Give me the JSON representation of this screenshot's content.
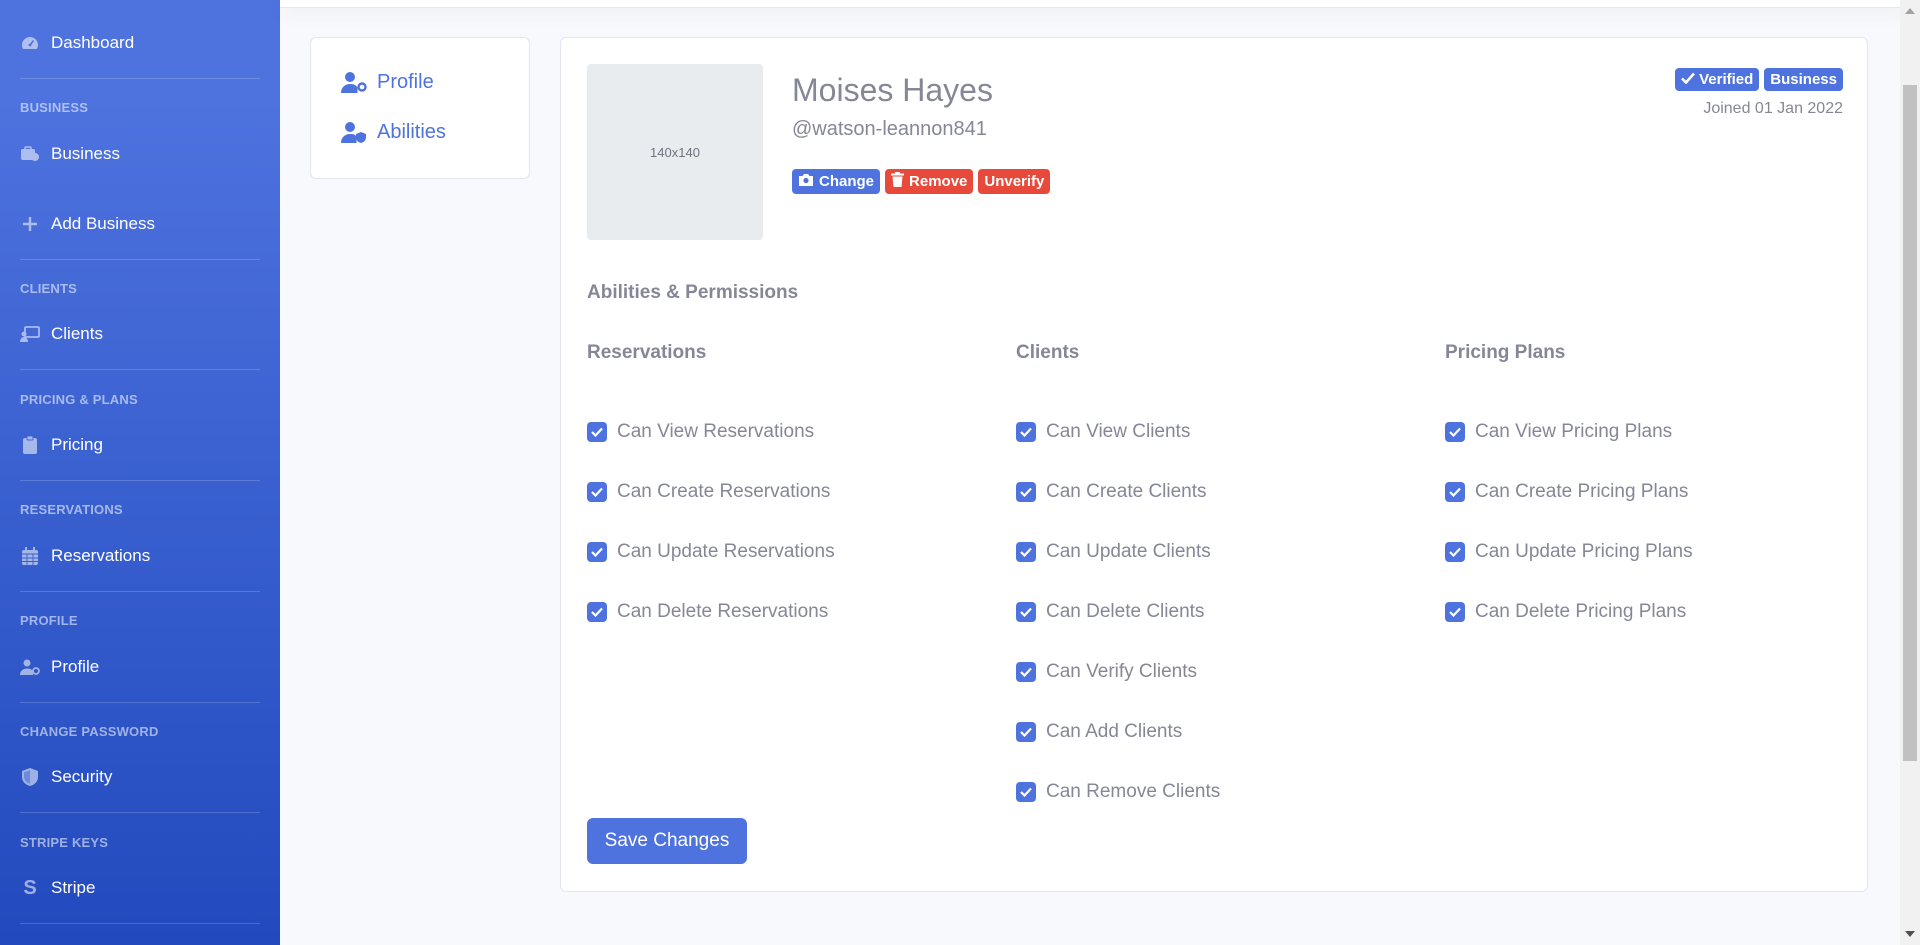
{
  "sidebar": {
    "dashboard": "Dashboard",
    "sections": [
      {
        "heading": "BUSINESS",
        "items": [
          "Business",
          "Add Business"
        ]
      },
      {
        "heading": "CLIENTS",
        "items": [
          "Clients"
        ]
      },
      {
        "heading": "PRICING & PLANS",
        "items": [
          "Pricing"
        ]
      },
      {
        "heading": "RESERVATIONS",
        "items": [
          "Reservations"
        ]
      },
      {
        "heading": "PROFILE",
        "items": [
          "Profile"
        ]
      },
      {
        "heading": "CHANGE PASSWORD",
        "items": [
          "Security"
        ]
      },
      {
        "heading": "STRIPE KEYS",
        "items": [
          "Stripe"
        ]
      }
    ]
  },
  "nav": {
    "profile": "Profile",
    "abilities": "Abilities"
  },
  "user": {
    "avatar_placeholder": "140x140",
    "name": "Moises Hayes",
    "handle": "@watson-leannon841",
    "joined": "Joined 01 Jan 2022",
    "status_badges": [
      "Verified",
      "Business"
    ]
  },
  "actions": {
    "change": "Change",
    "remove": "Remove",
    "unverify": "Unverify"
  },
  "permissions": {
    "title": "Abilities & Permissions",
    "columns": [
      {
        "title": "Reservations",
        "items": [
          "Can View Reservations",
          "Can Create Reservations",
          "Can Update Reservations",
          "Can Delete Reservations"
        ]
      },
      {
        "title": "Clients",
        "items": [
          "Can View Clients",
          "Can Create Clients",
          "Can Update Clients",
          "Can Delete Clients",
          "Can Verify Clients",
          "Can Add Clients",
          "Can Remove Clients"
        ]
      },
      {
        "title": "Pricing Plans",
        "items": [
          "Can View Pricing Plans",
          "Can Create Pricing Plans",
          "Can Update Pricing Plans",
          "Can Delete Pricing Plans"
        ]
      }
    ]
  },
  "save_label": "Save Changes",
  "colors": {
    "primary": "#4e73df",
    "danger": "#e74a3b",
    "text_muted": "#858796"
  }
}
